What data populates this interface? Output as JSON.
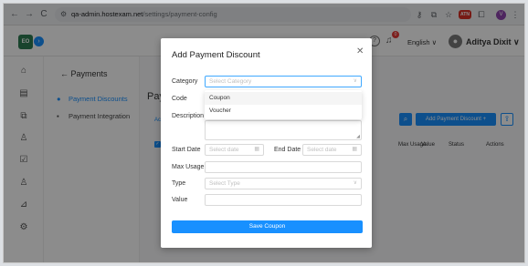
{
  "browser": {
    "back": "←",
    "forward": "→",
    "reload": "C",
    "url_host": "qa-admin.hostexam.net",
    "url_path": "/settings/payment-config",
    "ext_badge": "ATN",
    "profile": "V"
  },
  "header": {
    "logo": "EO",
    "collapse": "›",
    "language": "English ∨",
    "username": "Aditya Dixit ∨",
    "notification_count": "0"
  },
  "subnav": {
    "title": "Payments",
    "items": [
      {
        "label": "Payment Discounts",
        "active": true
      },
      {
        "label": "Payment Integration",
        "active": false
      }
    ]
  },
  "main": {
    "title": "Pay",
    "tab": "Acti",
    "add_button": "Add Payment Discount +",
    "columns": [
      "Max Usage",
      "Value",
      "Status",
      "Actions"
    ]
  },
  "modal": {
    "title": "Add Payment Discount",
    "fields": {
      "category_label": "Category",
      "category_placeholder": "Select Category",
      "code_label": "Code",
      "description_label": "Description",
      "start_date_label": "Start Date",
      "start_date_placeholder": "Select date",
      "end_date_label": "End Date",
      "end_date_placeholder": "Select date",
      "max_usage_label": "Max Usage",
      "type_label": "Type",
      "type_placeholder": "Select Type",
      "value_label": "Value"
    },
    "category_options": [
      "Coupon",
      "Voucher"
    ],
    "save_label": "Save Coupon"
  },
  "colors": {
    "primary": "#1890ff",
    "logo_bg": "#2e7d52",
    "overlay": "rgba(0,0,0,0.45)"
  }
}
